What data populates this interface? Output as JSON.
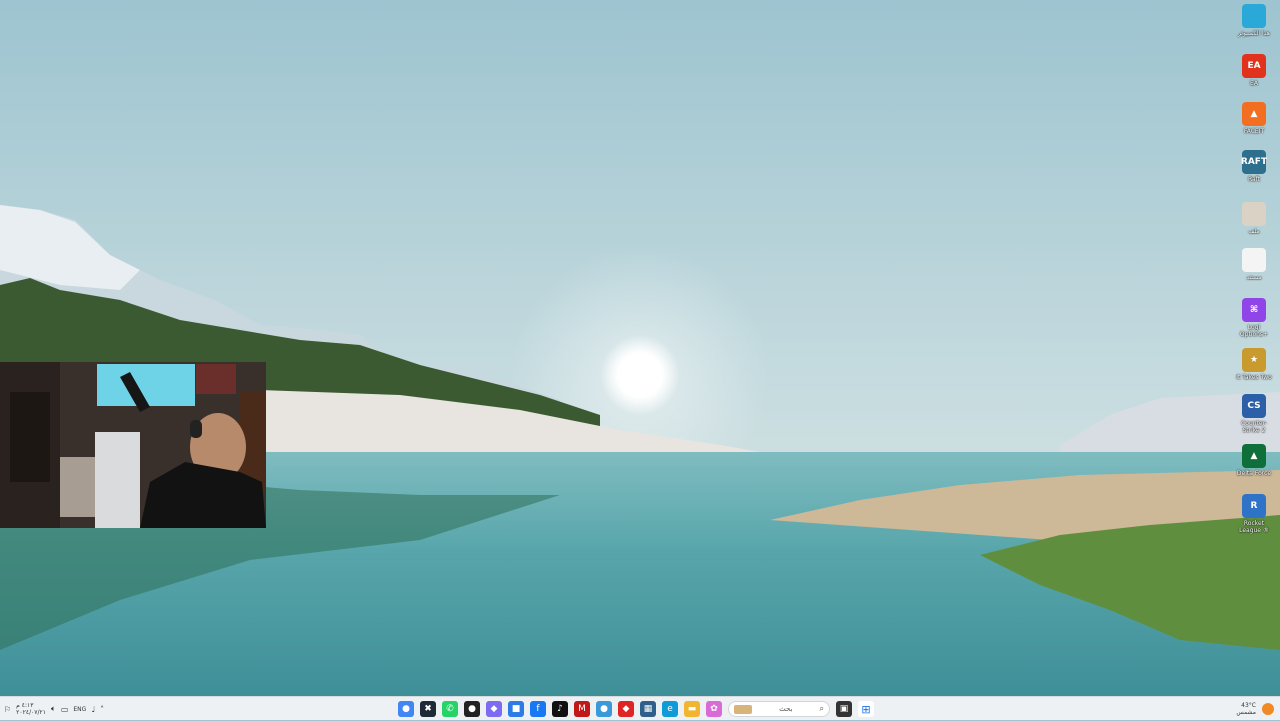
{
  "desktop": {
    "icons": [
      {
        "name": "desktop-icon-this-pc",
        "label": "هذا الكمبيوتر",
        "glyph": "",
        "color": "#2aa8d8"
      },
      {
        "name": "desktop-icon-ea",
        "label": "EA",
        "glyph": "EA",
        "color": "#e1321e"
      },
      {
        "name": "desktop-icon-faceit",
        "label": "FACEIT",
        "glyph": "▲",
        "color": "#f26f21"
      },
      {
        "name": "desktop-icon-raft",
        "label": "Raft",
        "glyph": "RAFT",
        "color": "#2e6f8e"
      },
      {
        "name": "desktop-icon-file",
        "label": "ملف",
        "glyph": "",
        "color": "#d9d2c5"
      },
      {
        "name": "desktop-icon-document",
        "label": "مستند",
        "glyph": "",
        "color": "#f4f4f4"
      },
      {
        "name": "desktop-icon-logi-options",
        "label": "Logi Options+",
        "glyph": "⌘",
        "color": "#8f45e8"
      },
      {
        "name": "desktop-icon-it-takes-two",
        "label": "It Takes Two",
        "glyph": "★",
        "color": "#c99a2e"
      },
      {
        "name": "desktop-icon-counter-strike",
        "label": "Counter-Strike 2",
        "glyph": "CS",
        "color": "#2b5fa8"
      },
      {
        "name": "desktop-icon-delta-force",
        "label": "Delta Force",
        "glyph": "▲",
        "color": "#0e6f3a"
      },
      {
        "name": "desktop-icon-rocket-league",
        "label": "Rocket League ®",
        "glyph": "R",
        "color": "#2f73c9"
      }
    ]
  },
  "taskbar": {
    "left": {
      "lang": "ENG",
      "date": "٢٠٢٤/٠٧/٢١",
      "time": "٤:١٣ م"
    },
    "search_placeholder": "بحث",
    "apps": [
      {
        "name": "chrome-icon",
        "glyph": "●",
        "color": "#4285f4"
      },
      {
        "name": "xbox-icon",
        "glyph": "✖",
        "color": "#1e2a38"
      },
      {
        "name": "whatsapp-icon",
        "glyph": "✆",
        "color": "#25d366"
      },
      {
        "name": "github-icon",
        "glyph": "●",
        "color": "#222222"
      },
      {
        "name": "discord-icon",
        "glyph": "◆",
        "color": "#7b6cf0"
      },
      {
        "name": "shield-icon",
        "glyph": "■",
        "color": "#2d7be5"
      },
      {
        "name": "facebook-icon",
        "glyph": "f",
        "color": "#1877f2"
      },
      {
        "name": "tiktok-icon",
        "glyph": "♪",
        "color": "#111111"
      },
      {
        "name": "mcafee-icon",
        "glyph": "M",
        "color": "#c01818"
      },
      {
        "name": "browser-icon",
        "glyph": "●",
        "color": "#3a9ad9"
      },
      {
        "name": "diamond-icon",
        "glyph": "◆",
        "color": "#e02424"
      },
      {
        "name": "calculator-icon",
        "glyph": "▦",
        "color": "#2f5f8a"
      },
      {
        "name": "edge-icon",
        "glyph": "e",
        "color": "#0f9bd7"
      },
      {
        "name": "folder-icon",
        "glyph": "▬",
        "color": "#f2b531"
      },
      {
        "name": "photos-icon",
        "glyph": "✿",
        "color": "#d86bd6"
      },
      {
        "name": "store-icon",
        "glyph": "▣",
        "color": "#333333"
      }
    ],
    "right": {
      "weather": "43°C",
      "weather_label": "مشمس"
    }
  }
}
